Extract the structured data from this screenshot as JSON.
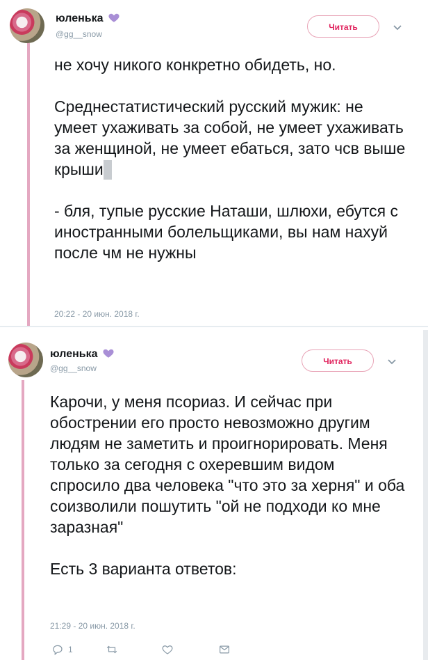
{
  "tweets": [
    {
      "display_name": "юленька",
      "handle": "@gg__snow",
      "follow_label": "Читать",
      "text_line1": "не хочу никого конкретно обидеть, но.",
      "text_para2": "Среднестатистический русский мужик: не умеет ухаживать за собой, не умеет ухаживать за женщиной, не умеет ебаться, зато чсв выше крыши",
      "text_para3": "- бля, тупые русские Наташи, шлюхи, ебутся с иностранными болельщиками, вы нам нахуй после чм не нужны",
      "timestamp": "20:22 - 20 июн. 2018 г."
    },
    {
      "display_name": "юленька",
      "handle": "@gg__snow",
      "follow_label": "Читать",
      "text_para1": "Карочи, у меня псориаз. И сейчас при обострении его просто невозможно другим людям не заметить и проигнорировать. Меня только за сегодня с охеревшим видом спросило два человека \"что это за херня\" и оба соизволили пошутить \"ой не подходи ко мне заразная\"",
      "text_para2": "Есть 3 варианта ответов:",
      "timestamp": "21:29 - 20 июн. 2018 г.",
      "reply_count": "1"
    }
  ],
  "icons": {
    "verified_like": "purple-heart-icon",
    "chevron": "chevron-down-icon",
    "reply": "reply-icon",
    "retweet": "retweet-icon",
    "like": "like-icon",
    "message": "message-icon"
  },
  "colors": {
    "accent": "#e0245e",
    "thread_line": "#e4a8c1",
    "heart": "#a98fd6",
    "muted": "#8899a6"
  }
}
